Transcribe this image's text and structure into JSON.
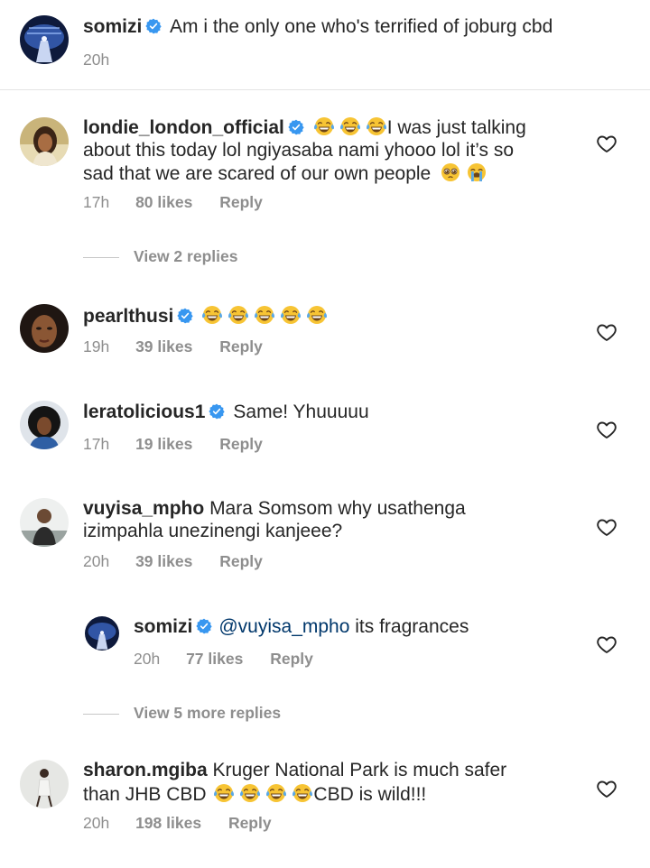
{
  "caption": {
    "username": "somizi",
    "text": "Am i the only one who's terrified of joburg cbd",
    "time": "20h"
  },
  "comments": [
    {
      "username": "londie_london_official",
      "text_line1": "I was just talking",
      "text_line2": "about this today lol ngiyasaba nami yhooo lol  it’s so",
      "text_line3": "sad that we are scared of our own people",
      "time": "17h",
      "likes": "80 likes",
      "reply": "Reply",
      "view_replies": "View 2 replies"
    },
    {
      "username": "pearlthusi",
      "time": "19h",
      "likes": "39 likes",
      "reply": "Reply"
    },
    {
      "username": "leratolicious1",
      "text": "Same! Yhuuuuu",
      "time": "17h",
      "likes": "19 likes",
      "reply": "Reply"
    },
    {
      "username": "vuyisa_mpho",
      "text_line1": "Mara Somsom why usathenga",
      "text_line2": "izimpahla unezinengi kanjeee?",
      "time": "20h",
      "likes": "39 likes",
      "reply": "Reply",
      "reply_item": {
        "username": "somizi",
        "mention": "@vuyisa_mpho",
        "text": "its fragrances",
        "time": "20h",
        "likes": "77 likes",
        "reply": "Reply"
      },
      "view_replies": "View 5 more replies"
    },
    {
      "username": "sharon.mgiba",
      "text_line1": "Kruger National Park is much safer",
      "text_line2_before": "than JHB CBD",
      "text_line2_after": "CBD is wild!!!",
      "time": "20h",
      "likes": "198 likes",
      "reply": "Reply"
    }
  ],
  "colors": {
    "text": "#262626",
    "secondary": "#8e8e8e",
    "verified": "#3897f0",
    "mention": "#00376b"
  },
  "icons": {
    "verified": "verified-badge-icon",
    "like": "heart-outline-icon",
    "laugh": "face-with-tears-of-joy-emoji",
    "pleading": "pleading-face-emoji",
    "crying": "loudly-crying-face-emoji"
  }
}
